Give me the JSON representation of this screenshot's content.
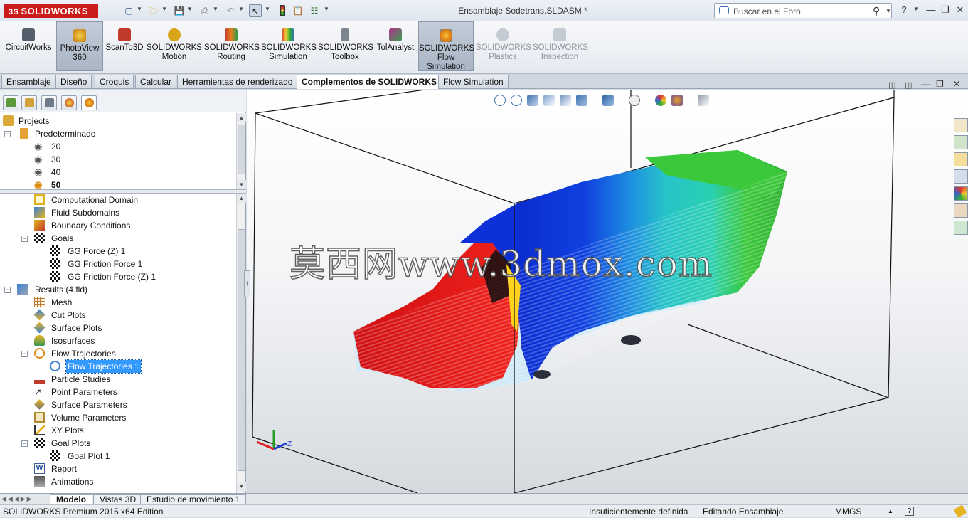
{
  "app": {
    "brand": "SOLIDWORKS",
    "brand_mark": "3S",
    "document_title": "Ensamblaje Sodetrans.SLDASM *"
  },
  "search": {
    "placeholder": "Buscar en el Foro"
  },
  "ribbon": {
    "buttons": [
      {
        "line1": "CircuitWorks",
        "line2": "",
        "line3": "",
        "icon": "circuitworks-icon",
        "color": "#555f6b"
      },
      {
        "line1": "PhotoView",
        "line2": "360",
        "line3": "",
        "icon": "photoview-icon",
        "color": "#e0a81c"
      },
      {
        "line1": "ScanTo3D",
        "line2": "",
        "line3": "",
        "icon": "scanto3d-icon",
        "color": "#c0392b"
      },
      {
        "line1": "SOLIDWORKS",
        "line2": "Motion",
        "line3": "",
        "icon": "motion-icon",
        "color": "#d9a61a"
      },
      {
        "line1": "SOLIDWORKS",
        "line2": "Routing",
        "line3": "",
        "icon": "routing-icon",
        "color": "#c0392b"
      },
      {
        "line1": "SOLIDWORKS",
        "line2": "Simulation",
        "line3": "",
        "icon": "simulation-icon",
        "color": "#2f9e44"
      },
      {
        "line1": "SOLIDWORKS",
        "line2": "Toolbox",
        "line3": "",
        "icon": "toolbox-icon",
        "color": "#7b858f"
      },
      {
        "line1": "TolAnalyst",
        "line2": "",
        "line3": "",
        "icon": "tolanalyst-icon",
        "color": "#b03090"
      },
      {
        "line1": "SOLIDWORKS",
        "line2": "Flow",
        "line3": "Simulation",
        "icon": "flow-simulation-icon",
        "color": "#e07a10"
      },
      {
        "line1": "SOLIDWORKS",
        "line2": "Plastics",
        "line3": "",
        "icon": "plastics-icon",
        "color": "#b7bec7"
      },
      {
        "line1": "SOLIDWORKS",
        "line2": "Inspection",
        "line3": "",
        "icon": "inspection-icon",
        "color": "#b7bec7"
      }
    ]
  },
  "tabs": [
    "Ensamblaje",
    "Diseño",
    "Croquis",
    "Calcular",
    "Herramientas de renderizado",
    "Complementos de SOLIDWORKS",
    "Flow Simulation"
  ],
  "tree_top": {
    "projects": "Projects",
    "config": "Predeterminado",
    "items": [
      "20",
      "30",
      "40",
      "50"
    ]
  },
  "tree": {
    "computational_domain": "Computational Domain",
    "fluid_subdomains": "Fluid Subdomains",
    "boundary_conditions": "Boundary Conditions",
    "goals": "Goals",
    "goal_items": [
      "GG Force (Z) 1",
      "GG Friction Force 1",
      "GG Friction Force (Z) 1"
    ],
    "results": "Results (4.fld)",
    "mesh": "Mesh",
    "cut_plots": "Cut Plots",
    "surface_plots": "Surface Plots",
    "isosurfaces": "Isosurfaces",
    "flow_trajectories": "Flow Trajectories",
    "flow_trajectories_1": "Flow Trajectories 1",
    "particle_studies": "Particle Studies",
    "point_parameters": "Point Parameters",
    "surface_parameters": "Surface Parameters",
    "volume_parameters": "Volume Parameters",
    "xy_plots": "XY Plots",
    "goal_plots": "Goal Plots",
    "goal_plot_1": "Goal Plot 1",
    "report": "Report",
    "animations": "Animations"
  },
  "bottom_tabs": [
    "Modelo",
    "Vistas 3D",
    "Estudio de movimiento 1"
  ],
  "status": {
    "edition": "SOLIDWORKS Premium 2015 x64 Edition",
    "definition": "Insuficientemente definida",
    "mode": "Editando Ensamblaje",
    "units": "MMGS"
  },
  "watermark": "莫西网www.3dmox.com",
  "triad": {
    "z": "Z"
  },
  "colors": {
    "accent": "#3399ff",
    "flow_red": "#e8161a",
    "flow_blue": "#1034d8",
    "flow_cyan": "#22c9c9",
    "flow_green": "#3cc82a"
  }
}
